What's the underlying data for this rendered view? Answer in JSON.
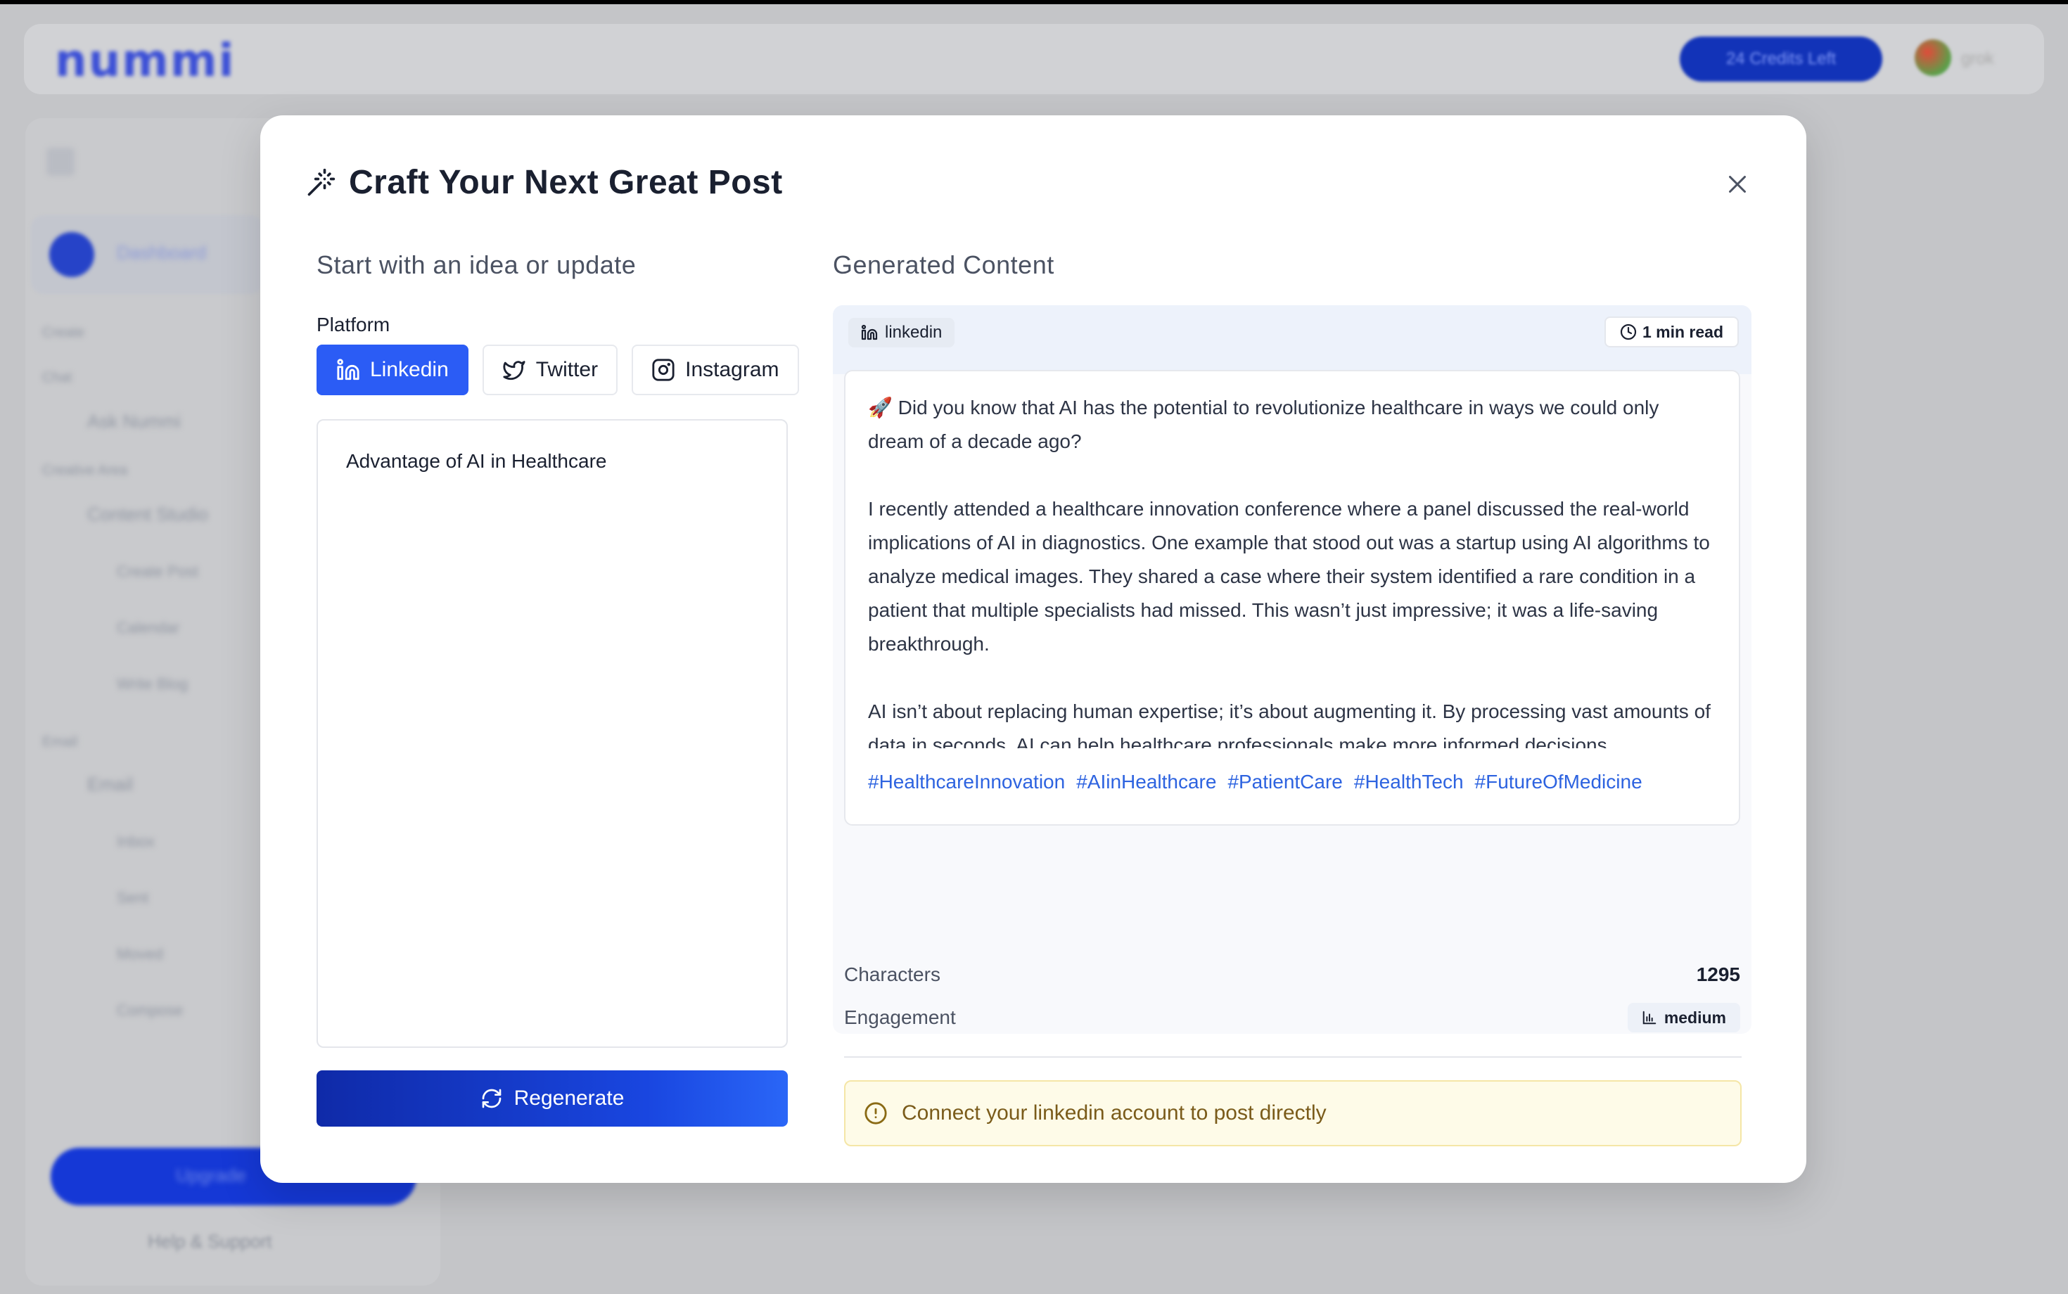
{
  "background": {
    "logo": "nummi",
    "credits_button": "24 Credits Left",
    "user_name": "grok",
    "sidebar": {
      "dashboard": "Dashboard",
      "create": "Create",
      "chat": "Chat",
      "ask_nummi": "Ask Nummi",
      "creative_area": "Creative Area",
      "content_studio": "Content Studio",
      "create_post": "Create Post",
      "calendar": "Calendar",
      "write_blog": "Write Blog",
      "email_section": "Email",
      "email": "Email",
      "inbox": "Inbox",
      "sent": "Sent",
      "moved": "Moved",
      "compose": "Compose",
      "upgrade": "Upgrade",
      "help": "Help & Support"
    }
  },
  "modal": {
    "title": "Craft Your Next Great Post",
    "left": {
      "heading": "Start with an idea or update",
      "platform_label": "Platform",
      "platforms": [
        {
          "label": "Linkedin",
          "icon": "linkedin-icon",
          "active": true
        },
        {
          "label": "Twitter",
          "icon": "twitter-icon",
          "active": false
        },
        {
          "label": "Instagram",
          "icon": "instagram-icon",
          "active": false
        }
      ],
      "idea_value": "Advantage of AI in Healthcare",
      "regenerate_label": "Regenerate"
    },
    "right": {
      "heading": "Generated Content",
      "platform_chip": "linkedin",
      "read_time": "1 min read",
      "post_paragraphs": [
        "🚀 Did you know that AI has the potential to revolutionize healthcare in ways we could only dream of a decade ago?",
        "I recently attended a healthcare innovation conference where a panel discussed the real-world implications of AI in diagnostics. One example that stood out was a startup using AI algorithms to analyze medical images. They shared a case where their system identified a rare condition in a patient that multiple specialists had missed. This wasn’t just impressive; it was a life-saving breakthrough.",
        "AI isn’t about replacing human expertise; it’s about augmenting it. By processing vast amounts of data in seconds, AI can help healthcare professionals make more informed decisions."
      ],
      "hashtags": [
        "#HealthcareInnovation",
        "#AIinHealthcare",
        "#PatientCare",
        "#HealthTech",
        "#FutureOfMedicine"
      ],
      "characters_label": "Characters",
      "characters_value": "1295",
      "engagement_label": "Engagement",
      "engagement_value": "medium",
      "alert": "Connect your linkedin account to post directly"
    }
  },
  "colors": {
    "accent": "#2b5cf5",
    "button_gradient_start": "#0f2aa8",
    "hashtag": "#2d63e0",
    "alert_bg": "#fefbe8",
    "alert_text": "#7a5b1a"
  }
}
